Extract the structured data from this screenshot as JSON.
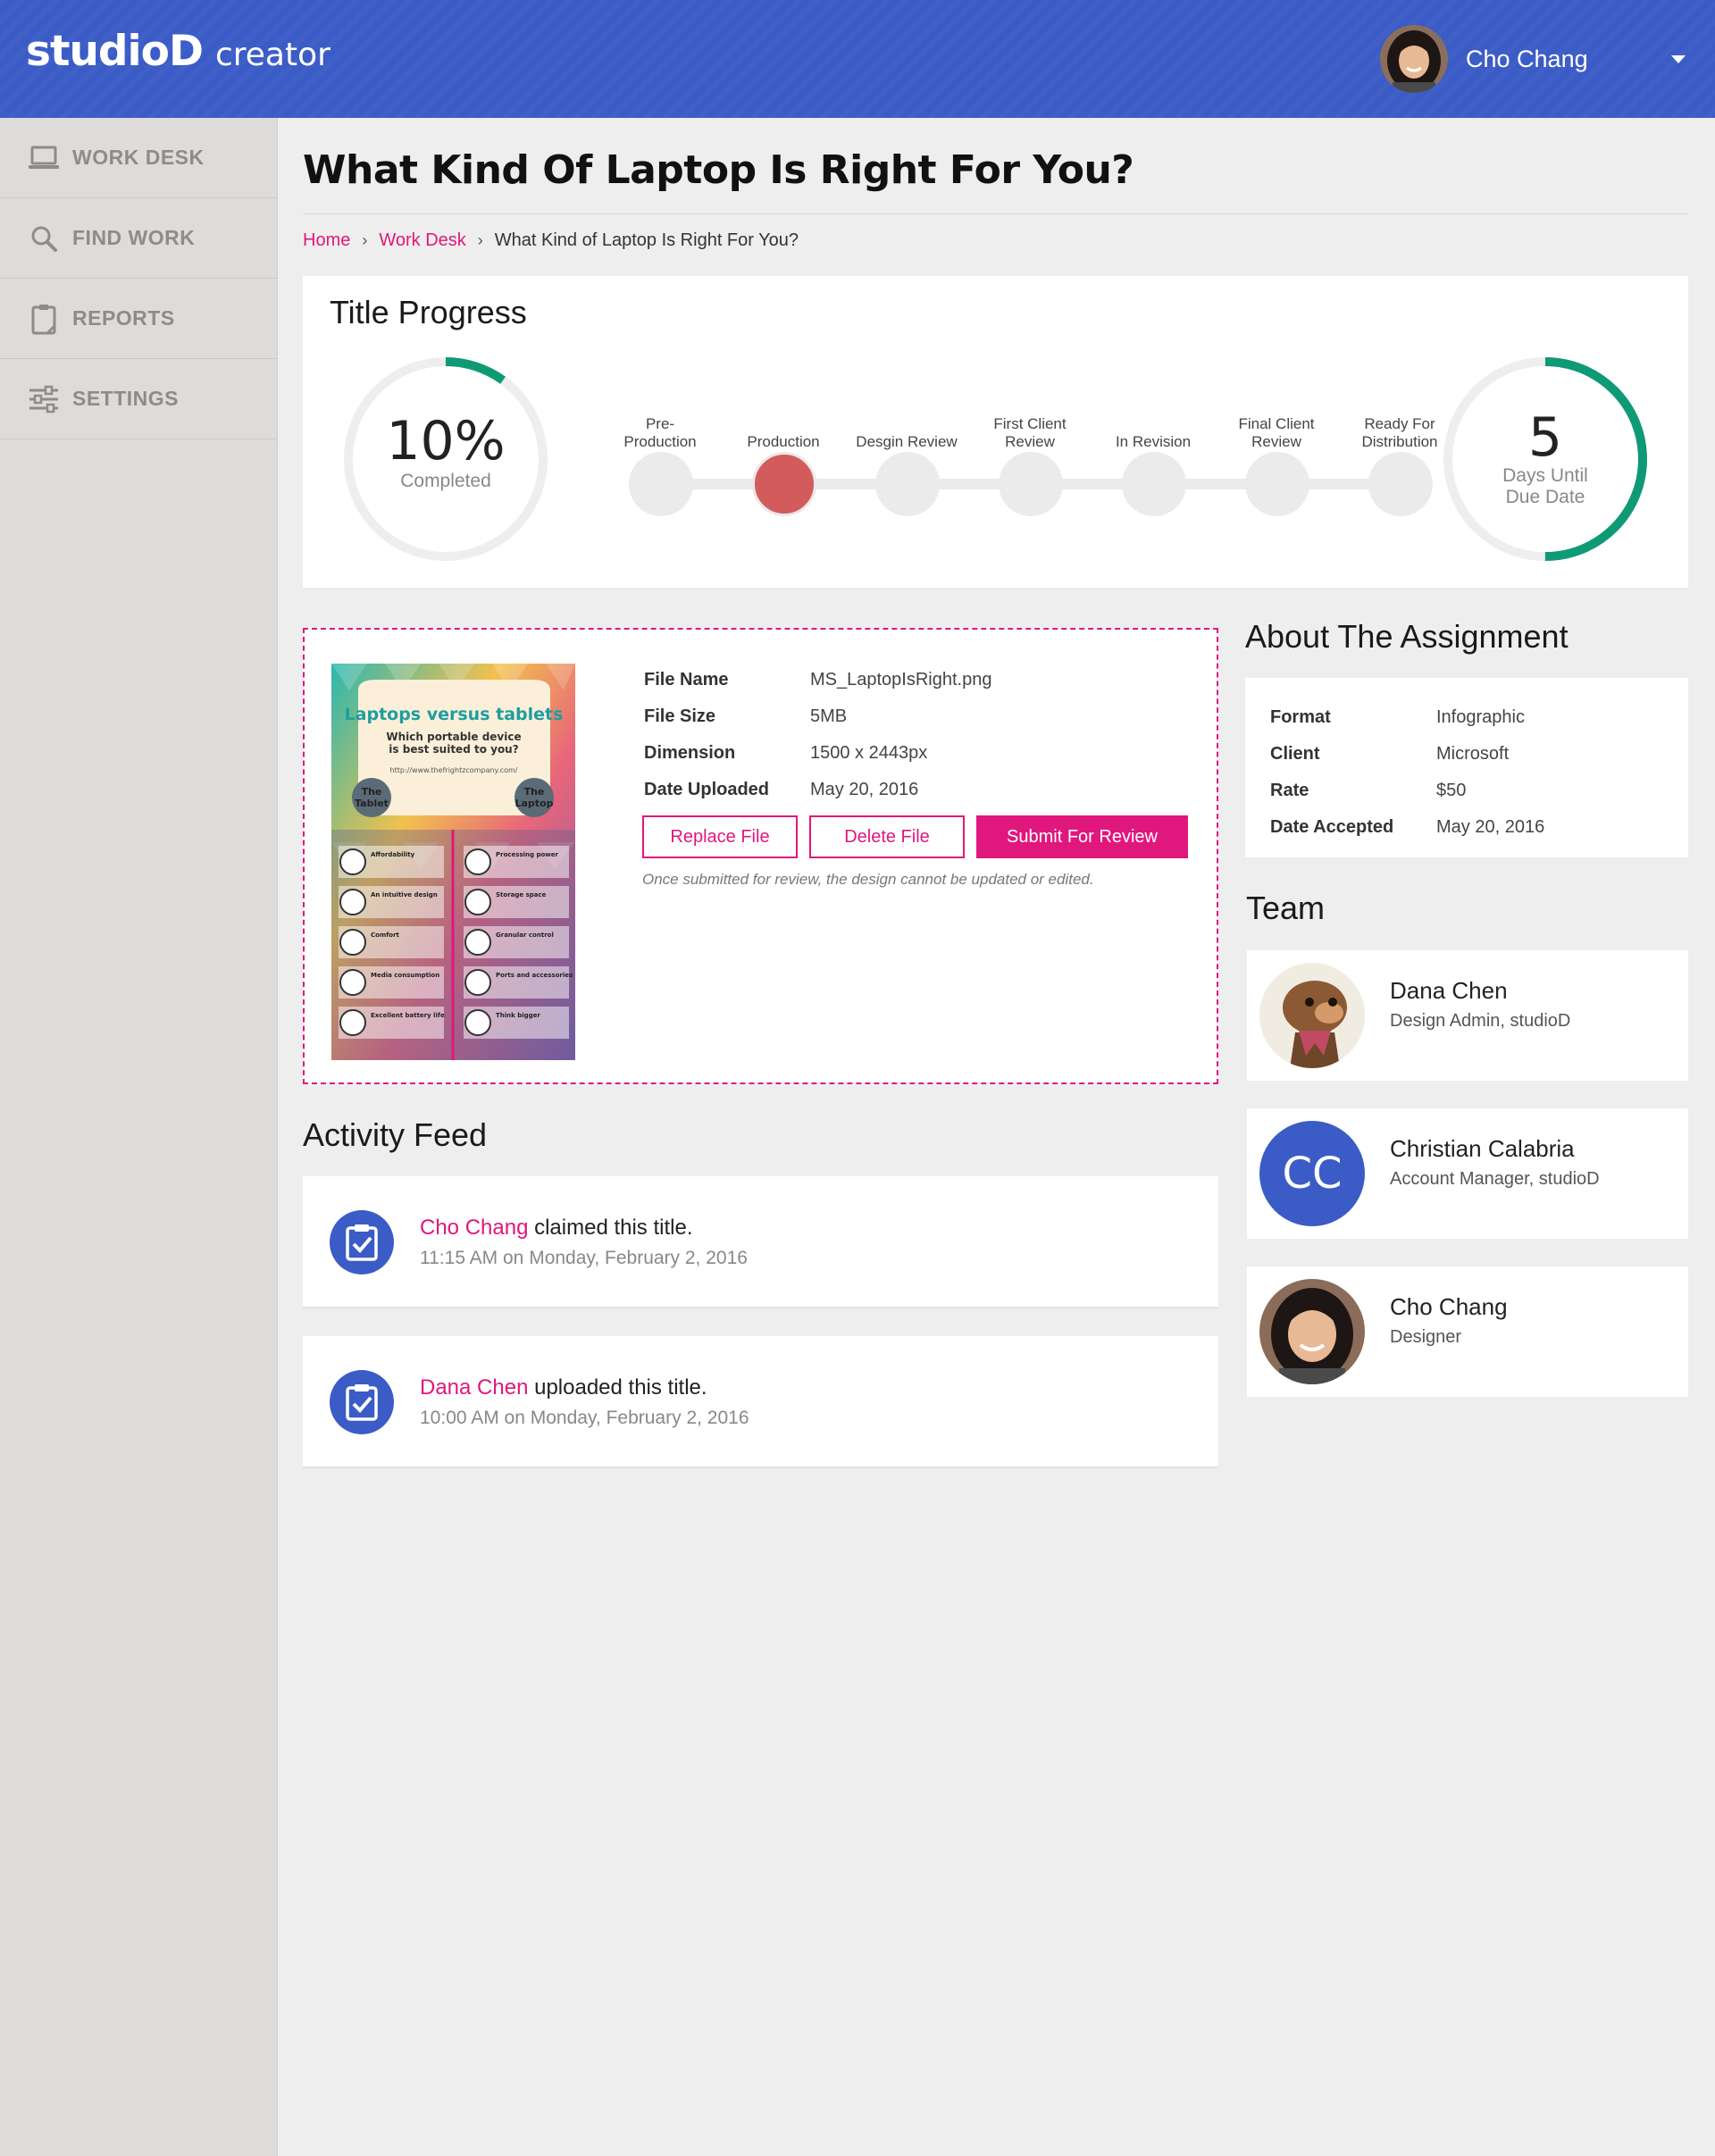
{
  "header": {
    "logo_main": "studioD",
    "logo_sub": "creator",
    "user_name": "Cho Chang"
  },
  "sidebar": {
    "items": [
      {
        "label": "WORK DESK",
        "icon": "laptop-icon"
      },
      {
        "label": "FIND WORK",
        "icon": "search-icon"
      },
      {
        "label": "REPORTS",
        "icon": "clipboard-icon"
      },
      {
        "label": "SETTINGS",
        "icon": "sliders-icon"
      }
    ]
  },
  "page": {
    "title": "What Kind Of Laptop Is Right For You?",
    "breadcrumb": [
      "Home",
      "Work Desk",
      "What Kind of Laptop Is Right For You?"
    ]
  },
  "progress": {
    "heading": "Title Progress",
    "percent_label": "10%",
    "percent_value": 0.1,
    "percent_caption": "Completed",
    "days_value": "5",
    "days_caption_1": "Days Until",
    "days_caption_2": "Due Date",
    "days_ring_fraction": 0.5,
    "steps": [
      {
        "line1": "Pre-",
        "line2": "Production",
        "active": false
      },
      {
        "line1": "",
        "line2": "Production",
        "active": true
      },
      {
        "line1": "",
        "line2": "Desgin Review",
        "active": false
      },
      {
        "line1": "First Client",
        "line2": "Review",
        "active": false
      },
      {
        "line1": "",
        "line2": "In Revision",
        "active": false
      },
      {
        "line1": "Final Client",
        "line2": "Review",
        "active": false
      },
      {
        "line1": "Ready For",
        "line2": "Distribution",
        "active": false
      }
    ],
    "colors": {
      "ring": "#0f9a76",
      "active_step": "#d25c5c"
    }
  },
  "file": {
    "rows": [
      {
        "k": "File Name",
        "v": "MS_LaptopIsRight.png"
      },
      {
        "k": "File Size",
        "v": "5MB"
      },
      {
        "k": "Dimension",
        "v": "1500 x 2443px"
      },
      {
        "k": "Date Uploaded",
        "v": "May 20, 2016"
      }
    ],
    "replace_label": "Replace File",
    "delete_label": "Delete File",
    "submit_label": "Submit For Review",
    "note": "Once submitted for review, the design cannot be updated or edited.",
    "thumb": {
      "title": "Laptops versus tablets",
      "question": "Which portable device is best suited to you?",
      "url": "http://www.thefrightzcompany.com/",
      "left_label": "The Tablet",
      "right_label": "The Laptop",
      "left_items": [
        "Affordability",
        "An intuitive design",
        "Comfort",
        "Media consumption",
        "Excellent battery life"
      ],
      "right_items": [
        "Processing power",
        "Storage space",
        "Granular control",
        "Ports and accessories",
        "Think bigger"
      ]
    }
  },
  "about": {
    "heading": "About The Assignment",
    "rows": [
      {
        "k": "Format",
        "v": "Infographic"
      },
      {
        "k": "Client",
        "v": "Microsoft"
      },
      {
        "k": "Rate",
        "v": "$50"
      },
      {
        "k": "Date Accepted",
        "v": "May 20, 2016"
      }
    ]
  },
  "team": {
    "heading": "Team",
    "members": [
      {
        "name": "Dana Chen",
        "role": "Design Admin, studioD",
        "initials": ""
      },
      {
        "name": "Christian Calabria",
        "role": "Account Manager, studioD",
        "initials": "CC"
      },
      {
        "name": "Cho Chang",
        "role": "Designer",
        "initials": ""
      }
    ]
  },
  "activity": {
    "heading": "Activity Feed",
    "items": [
      {
        "who": "Cho Chang",
        "action": " claimed this title.",
        "time": "11:15 AM on Monday, February 2, 2016"
      },
      {
        "who": "Dana Chen",
        "action": " uploaded this title.",
        "time": "10:00 AM on Monday, February 2, 2016"
      }
    ]
  },
  "colors": {
    "brand": "#3b5cc6",
    "accent": "#e0177d",
    "ring": "#0f9a76"
  }
}
